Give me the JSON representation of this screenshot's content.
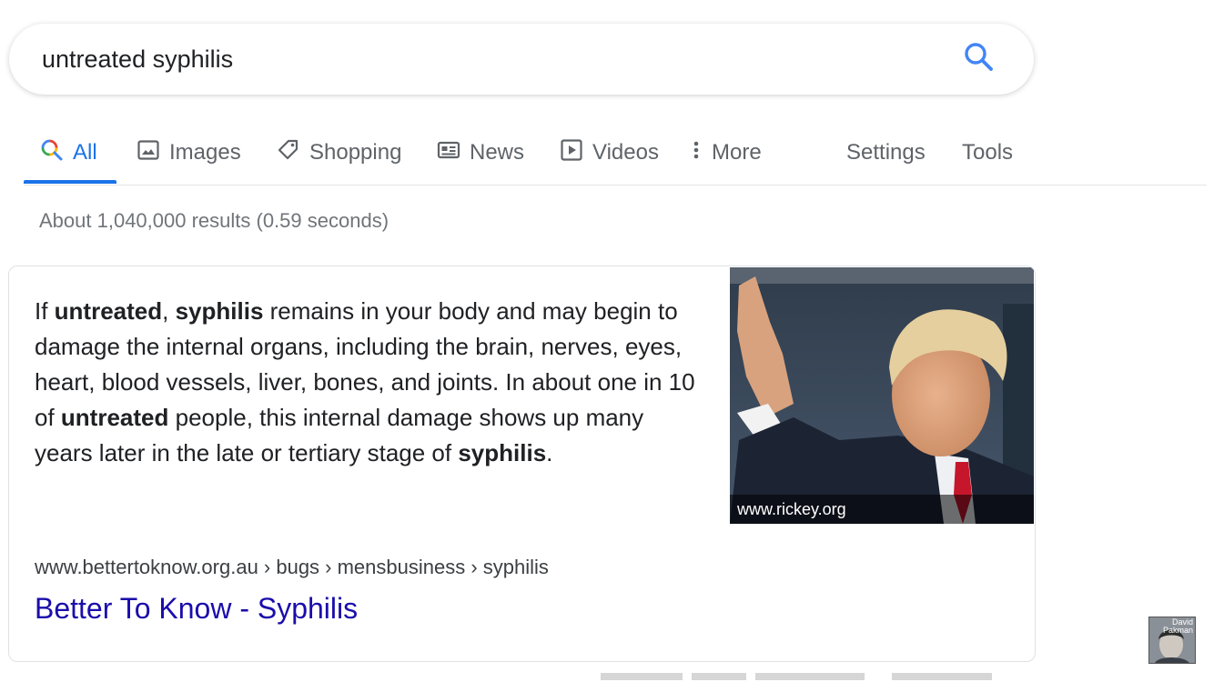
{
  "search": {
    "query": "untreated syphilis"
  },
  "tabs": [
    {
      "label": "All",
      "icon": "search-icon",
      "active": true
    },
    {
      "label": "Images",
      "icon": "image-icon",
      "active": false
    },
    {
      "label": "Shopping",
      "icon": "tag-icon",
      "active": false
    },
    {
      "label": "News",
      "icon": "newspaper-icon",
      "active": false
    },
    {
      "label": "Videos",
      "icon": "play-icon",
      "active": false
    },
    {
      "label": "More",
      "icon": "more-vert-icon",
      "active": false
    }
  ],
  "tools": {
    "settings_label": "Settings",
    "tools_label": "Tools"
  },
  "result_stats": "About 1,040,000 results (0.59 seconds)",
  "featured_snippet": {
    "segments": [
      {
        "text": "If ",
        "bold": false
      },
      {
        "text": "untreated",
        "bold": true
      },
      {
        "text": ", ",
        "bold": false
      },
      {
        "text": "syphilis",
        "bold": true
      },
      {
        "text": " remains in your body and may begin to damage the internal organs, including the brain, nerves, eyes, heart, blood vessels, liver, bones, and joints. In about one in 10 of ",
        "bold": false
      },
      {
        "text": "untreated",
        "bold": true
      },
      {
        "text": " people, this internal damage shows up many years later in the late or tertiary stage of ",
        "bold": false
      },
      {
        "text": "syphilis",
        "bold": true
      },
      {
        "text": ".",
        "bold": false
      }
    ],
    "image_caption": "www.rickey.org",
    "breadcrumb": "www.bettertoknow.org.au › bugs › mensbusiness › syphilis",
    "title": "Better To Know - Syphilis"
  },
  "avatar": {
    "label_line1": "David",
    "label_line2": "Pakman"
  },
  "colors": {
    "accent": "#1a73e8",
    "link": "#1a0dab",
    "muted": "#70757a"
  }
}
